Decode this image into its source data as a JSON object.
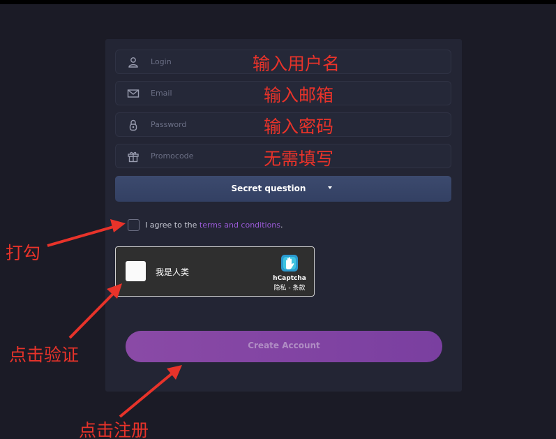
{
  "form": {
    "login_placeholder": "Login",
    "email_placeholder": "Email",
    "password_placeholder": "Password",
    "promocode_placeholder": "Promocode",
    "secret_question_label": "Secret question",
    "agree_prefix": "I agree to the ",
    "agree_link": "terms and conditions",
    "agree_suffix": ".",
    "create_account_label": "Create Account"
  },
  "captcha": {
    "human_label": "我是人类",
    "brand": "hCaptcha",
    "privacy_terms": "隐私 - 条款"
  },
  "annotations": {
    "login_note": "输入用户名",
    "email_note": "输入邮箱",
    "password_note": "输入密码",
    "promocode_note": "无需填写",
    "check_note": "打勾",
    "verify_note": "点击验证",
    "register_note": "点击注册"
  },
  "colors": {
    "background": "#1b1b26",
    "panel": "#232534",
    "select_button": "#3a476a",
    "create_button": "#8a4aa6",
    "link": "#9b5bd8",
    "annotation": "#e8332a"
  }
}
